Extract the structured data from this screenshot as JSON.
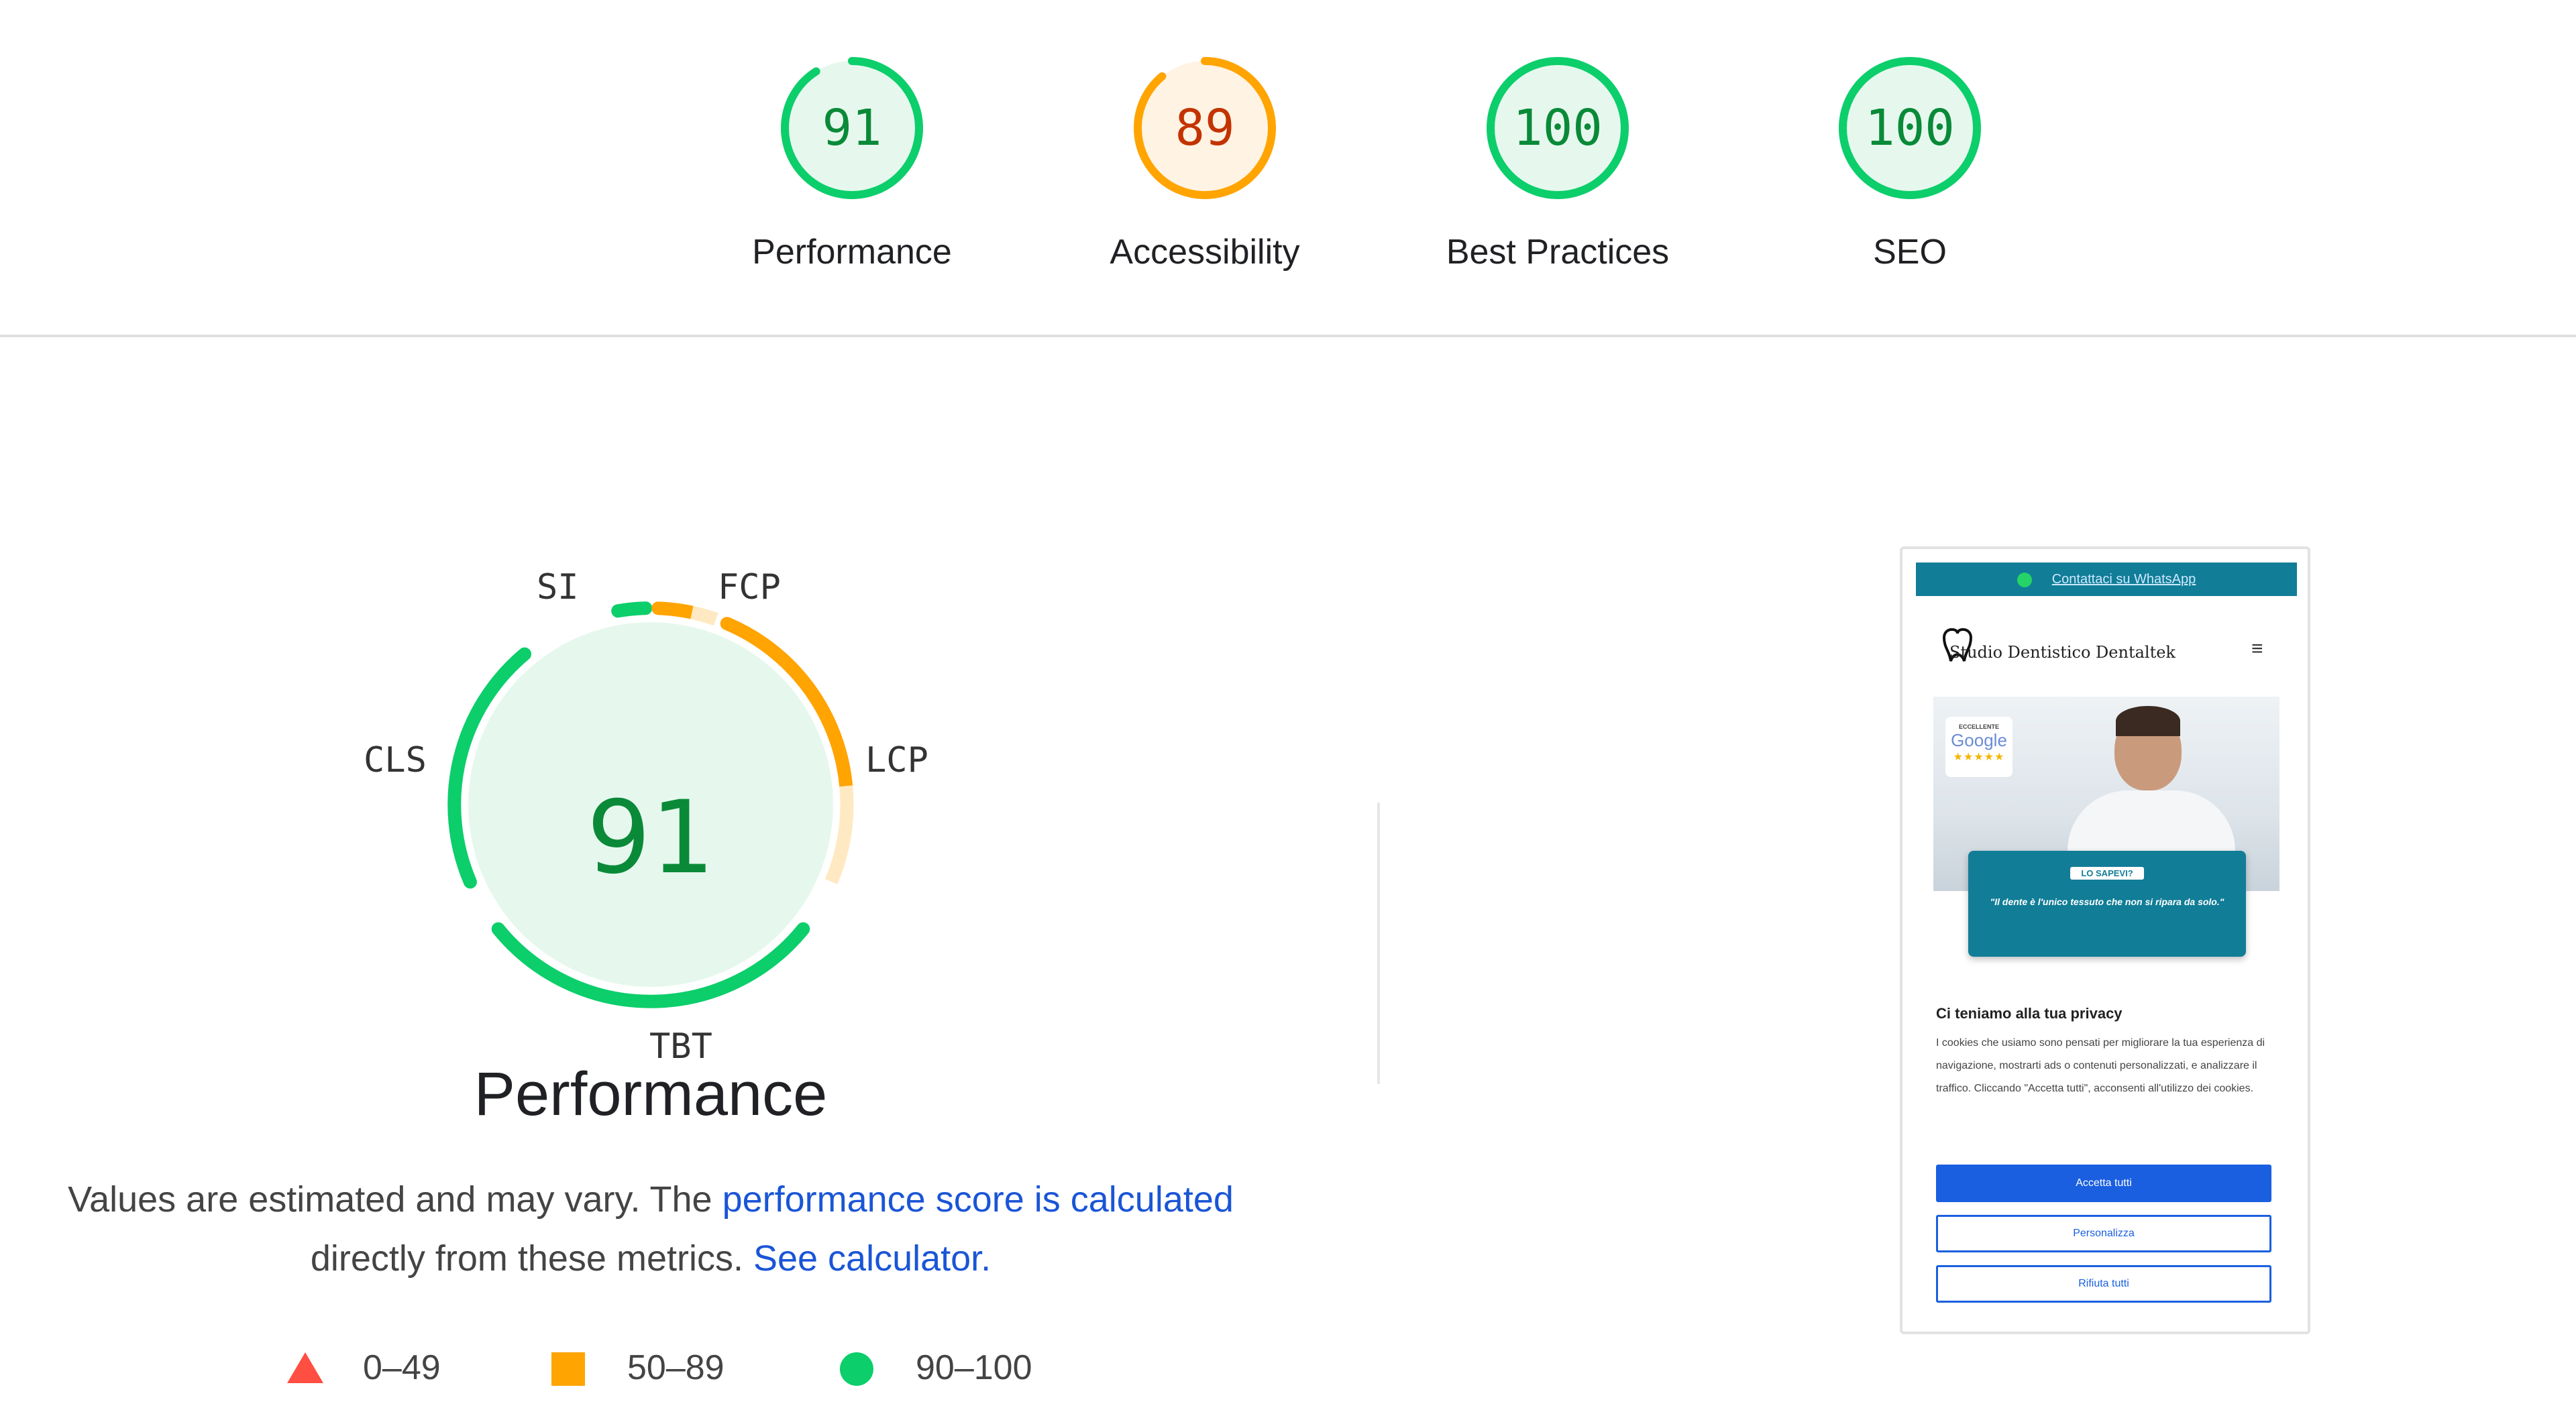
{
  "categories": [
    {
      "label": "Performance",
      "score": "91",
      "value": 91,
      "status": "pass"
    },
    {
      "label": "Accessibility",
      "score": "89",
      "value": 89,
      "status": "average"
    },
    {
      "label": "Best Practices",
      "score": "100",
      "value": 100,
      "status": "pass"
    },
    {
      "label": "SEO",
      "score": "100",
      "value": 100,
      "status": "pass"
    }
  ],
  "performance": {
    "score": "91",
    "title": "Performance",
    "metrics": {
      "si": "SI",
      "fcp": "FCP",
      "lcp": "LCP",
      "tbt": "TBT",
      "cls": "CLS"
    },
    "description": {
      "part1": "Values are estimated and may vary. The ",
      "link1": "performance score is calculated",
      "part2": " directly from these metrics. ",
      "link2": "See calculator."
    }
  },
  "legend": [
    {
      "label": "0–49",
      "shape": "triangle"
    },
    {
      "label": "50–89",
      "shape": "square"
    },
    {
      "label": "90–100",
      "shape": "circle"
    }
  ],
  "colors": {
    "pass": "#0cce6b",
    "pass_text": "#0a8a38",
    "pass_bg": "#e6f8ee",
    "average": "#ffa400",
    "average_text": "#c33300",
    "average_bg": "#fff3e3",
    "fail": "#ff4e42",
    "link": "#1a55d6"
  },
  "screenshot": {
    "whatsapp_bar": "Contattaci su WhatsApp",
    "site_name": "Studio Dentistico Dentaltek",
    "google_badge": {
      "line1": "ECCELLENTE",
      "line2": "Google",
      "line3": "★★★★★"
    },
    "quote_pill": "LO SAPEVI?",
    "quote": "\"Il dente è l'unico tessuto che non si ripara da solo.\"",
    "privacy_title": "Ci teniamo alla tua privacy",
    "privacy_text": "I cookies che usiamo sono pensati per migliorare la tua esperienza di navigazione, mostrarti ads o contenuti personalizzati, e analizzare il traffico. Cliccando \"Accetta tutti\", acconsenti all'utilizzo dei cookies.",
    "btn_accept": "Accetta tutti",
    "btn_customize": "Personalizza",
    "btn_reject": "Rifiuta tutti"
  }
}
